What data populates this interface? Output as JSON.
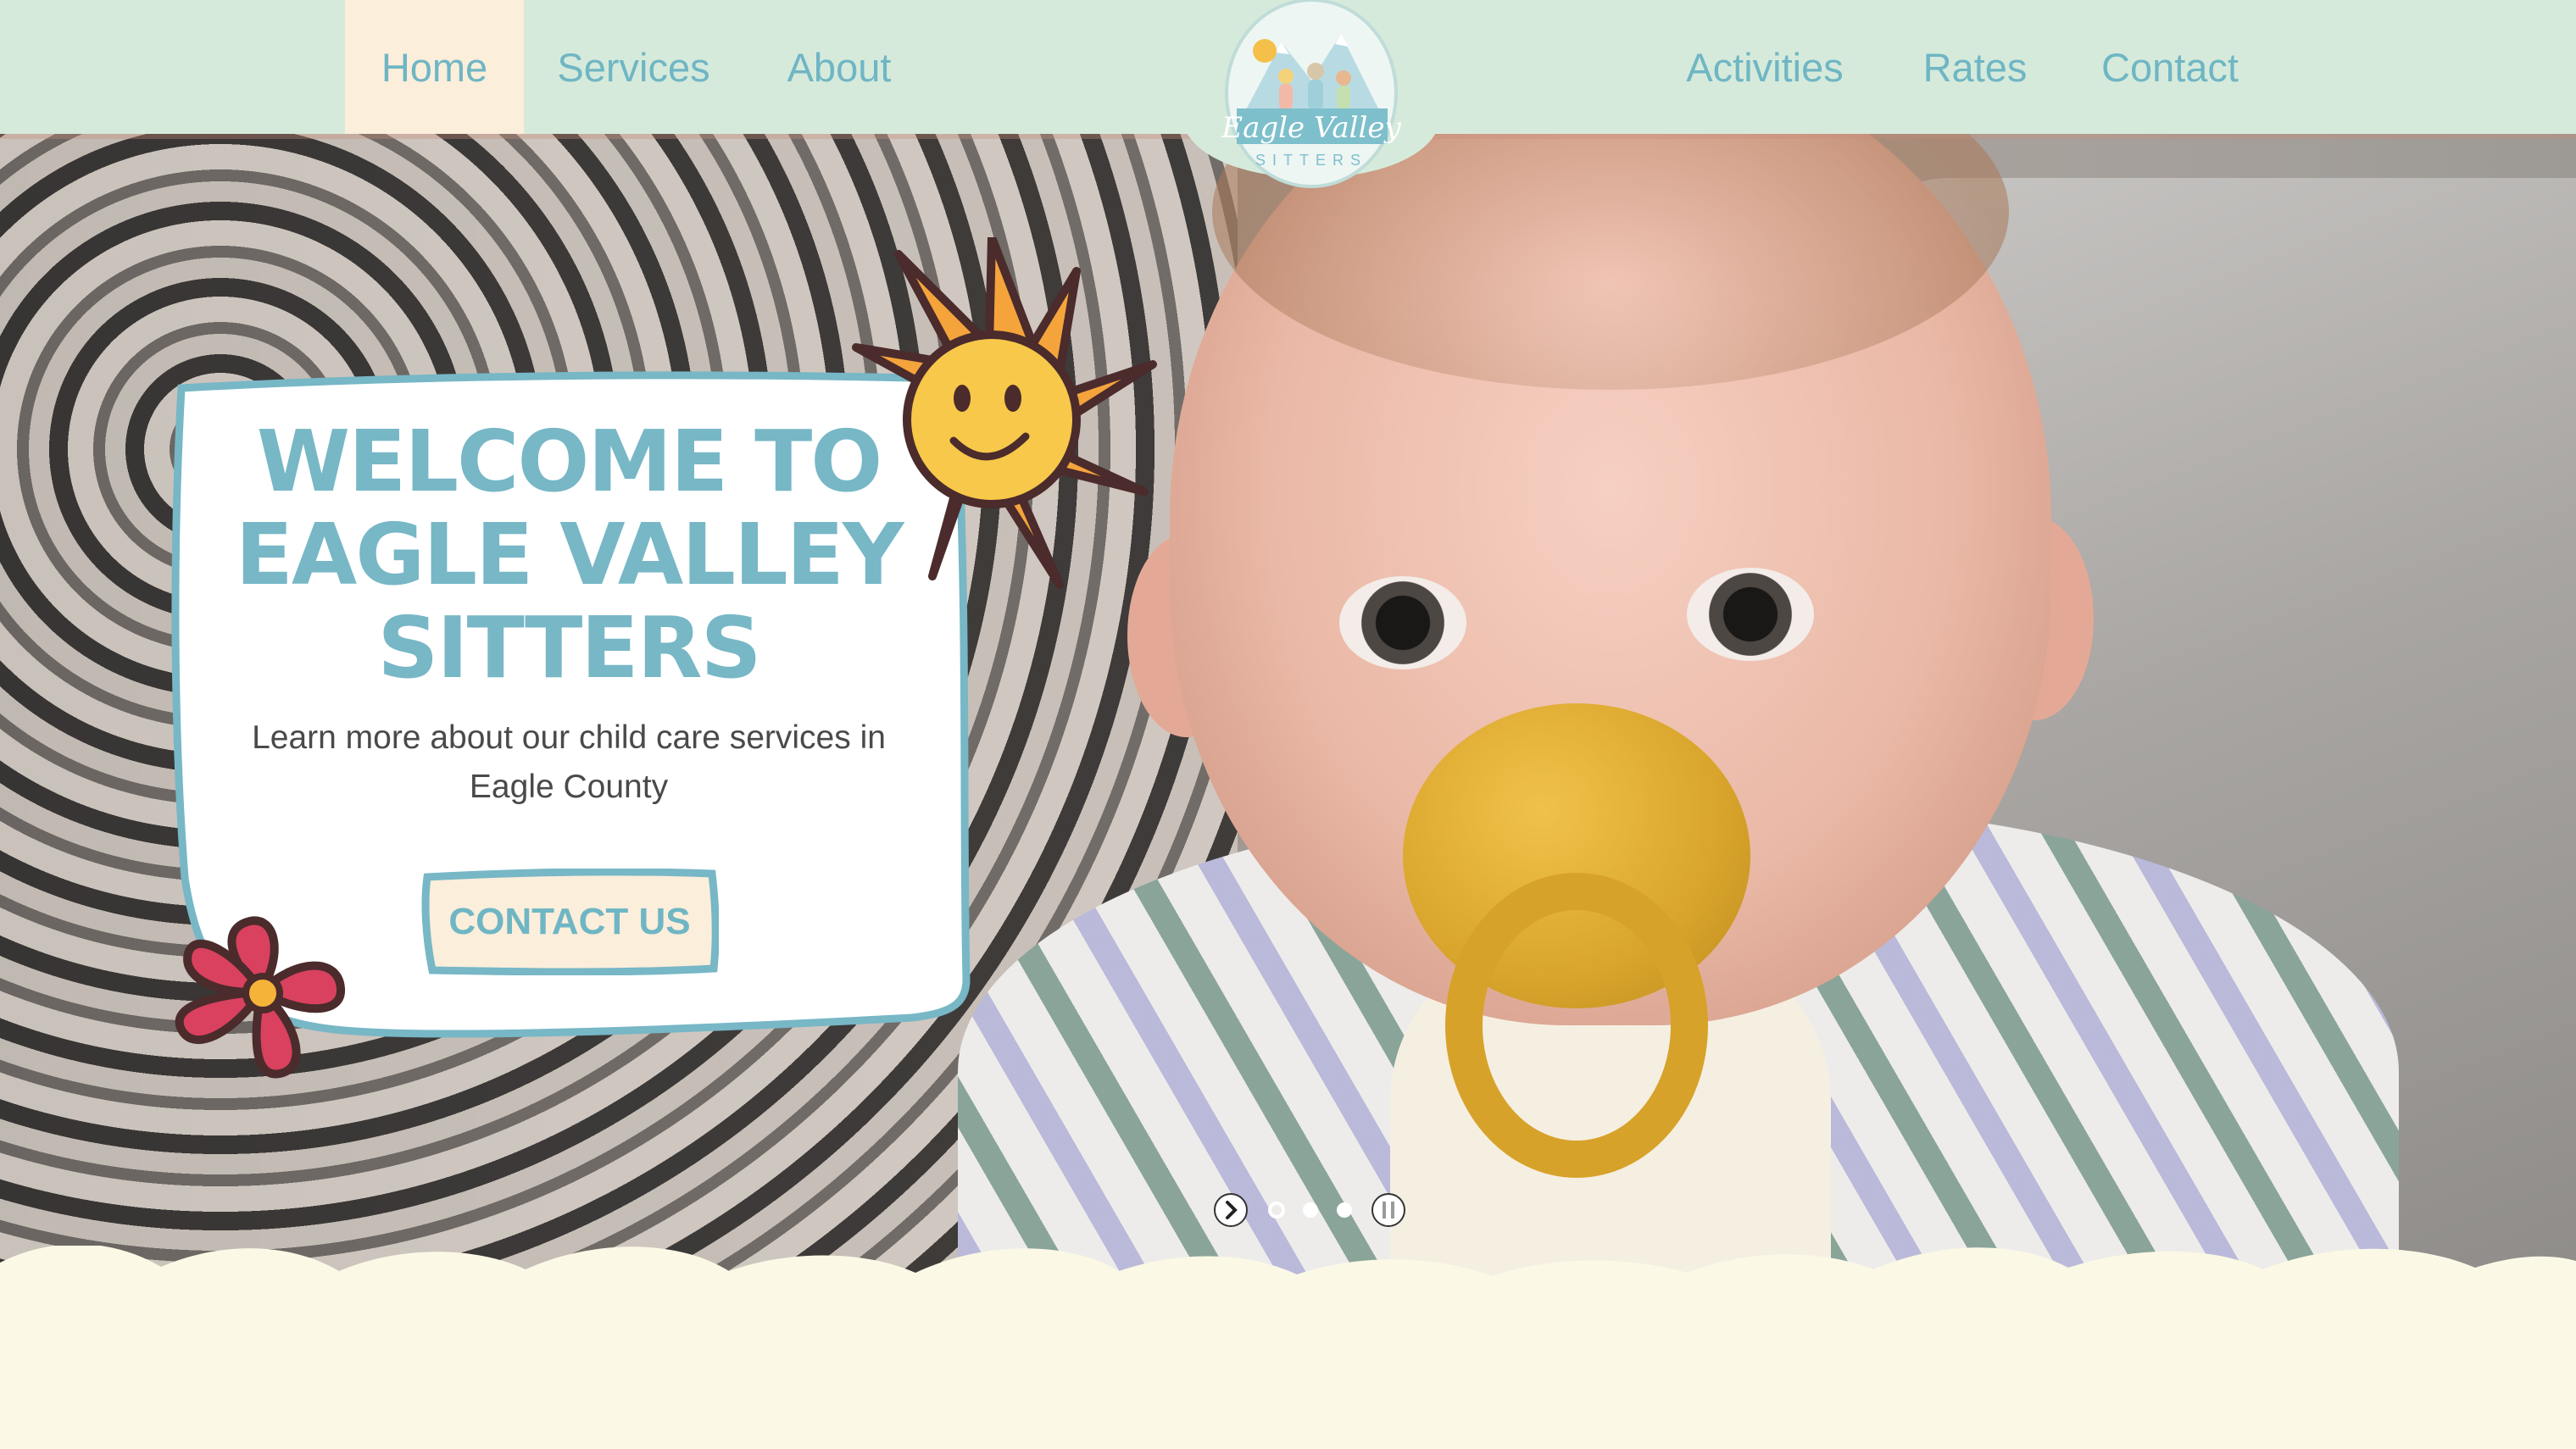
{
  "nav": {
    "left": [
      {
        "label": "Home",
        "active": true
      },
      {
        "label": "Services",
        "active": false
      },
      {
        "label": "About",
        "active": false
      }
    ],
    "right": [
      {
        "label": "Activities",
        "active": false
      },
      {
        "label": "Rates",
        "active": false
      },
      {
        "label": "Contact",
        "active": false
      }
    ],
    "logo": {
      "script": "Eagle Valley",
      "caps": "SITTERS"
    }
  },
  "hero": {
    "title_lines": [
      "WELCOME TO",
      "EAGLE VALLEY",
      "SITTERS"
    ],
    "subtitle": "Learn more about our child care services in Eagle County",
    "cta_label": "CONTACT US"
  },
  "slider": {
    "slides": 3,
    "current_slide": 1,
    "icons": [
      "next-arrow-icon",
      "slide-dot-icon",
      "pause-icon"
    ]
  },
  "colors": {
    "nav_bg": "#d6eadb",
    "nav_text": "#6fb6c4",
    "active_tab_bg": "#fbeedb",
    "card_border": "#77b7c6",
    "title": "#77b7c6",
    "cta_bg": "#fbeedb",
    "footer_bg": "#fbf9e6",
    "sun": "#f5a43c",
    "flower": "#d9415f"
  }
}
